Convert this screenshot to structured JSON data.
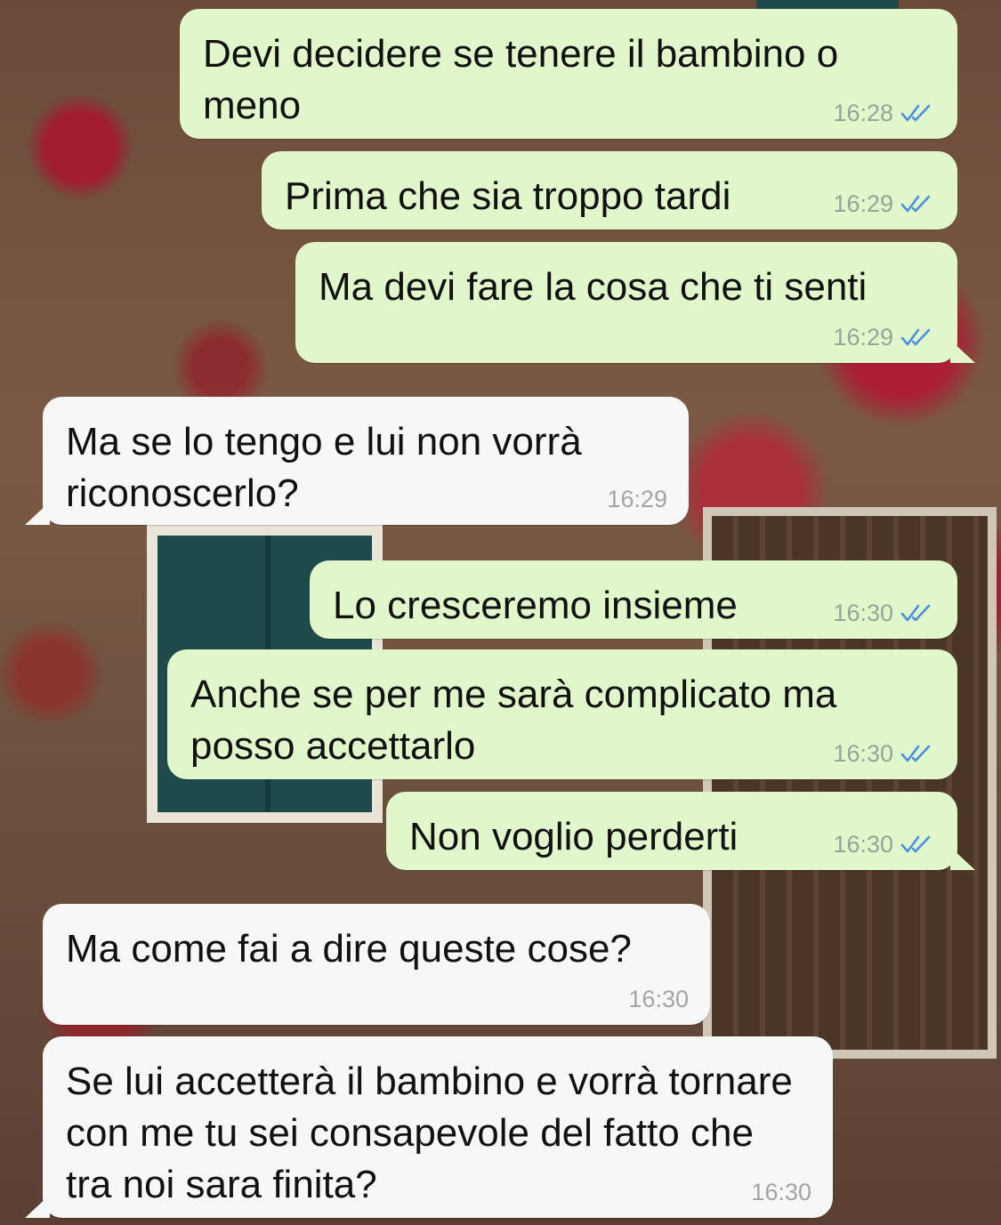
{
  "messages": [
    {
      "direction": "out",
      "text": "Devi decidere se tenere il bambino o meno",
      "time": "16:28",
      "status_icon": "double-check-icon"
    },
    {
      "direction": "out",
      "text": "Prima che sia troppo tardi",
      "time": "16:29",
      "status_icon": "double-check-icon"
    },
    {
      "direction": "out",
      "text": "Ma devi fare la cosa che ti senti",
      "time": "16:29",
      "status_icon": "double-check-icon"
    },
    {
      "direction": "in",
      "text": "Ma se lo tengo e lui non vorrà riconoscerlo?",
      "time": "16:29"
    },
    {
      "direction": "out",
      "text": "Lo cresceremo insieme",
      "time": "16:30",
      "status_icon": "double-check-icon"
    },
    {
      "direction": "out",
      "text": "Anche se per me sarà complicato ma posso accettarlo",
      "time": "16:30",
      "status_icon": "double-check-icon"
    },
    {
      "direction": "out",
      "text": "Non voglio perderti",
      "time": "16:30",
      "status_icon": "double-check-icon"
    },
    {
      "direction": "in",
      "text": "Ma come fai a dire queste cose?",
      "time": "16:30"
    },
    {
      "direction": "in",
      "text": "Se lui accetterà il bambino e vorrà tornare con me tu sei consapevole del fatto che tra noi sara finita?",
      "time": "16:30"
    }
  ],
  "colors": {
    "outgoing_bubble": "#e1f7cb",
    "incoming_bubble": "#f7f7f7",
    "read_ticks": "#4a90e2",
    "timestamp": "#9aa39a"
  }
}
